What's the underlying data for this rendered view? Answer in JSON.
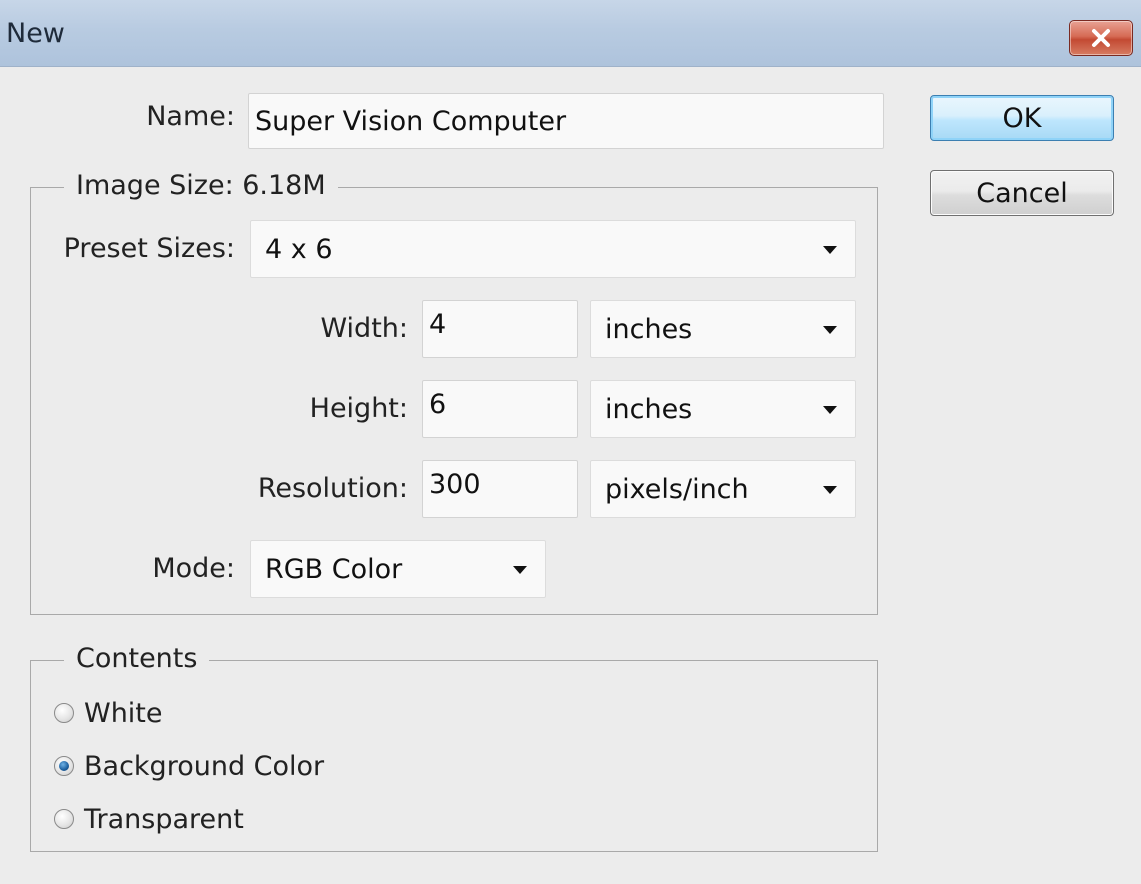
{
  "window": {
    "title": "New",
    "close_icon": "close-icon"
  },
  "name": {
    "label": "Name:",
    "value": "Super Vision Computer"
  },
  "buttons": {
    "ok": "OK",
    "cancel": "Cancel"
  },
  "image_size": {
    "legend": "Image Size: 6.18M",
    "preset": {
      "label": "Preset Sizes:",
      "value": "4 x 6"
    },
    "width": {
      "label": "Width:",
      "value": "4",
      "unit": "inches"
    },
    "height": {
      "label": "Height:",
      "value": "6",
      "unit": "inches"
    },
    "resolution": {
      "label": "Resolution:",
      "value": "300",
      "unit": "pixels/inch"
    },
    "mode": {
      "label": "Mode:",
      "value": "RGB Color"
    }
  },
  "contents": {
    "legend": "Contents",
    "options": [
      {
        "label": "White",
        "checked": false
      },
      {
        "label": "Background Color",
        "checked": true
      },
      {
        "label": "Transparent",
        "checked": false
      }
    ]
  },
  "colors": {
    "accent": "#3c7fb1",
    "close": "#c34a33"
  }
}
